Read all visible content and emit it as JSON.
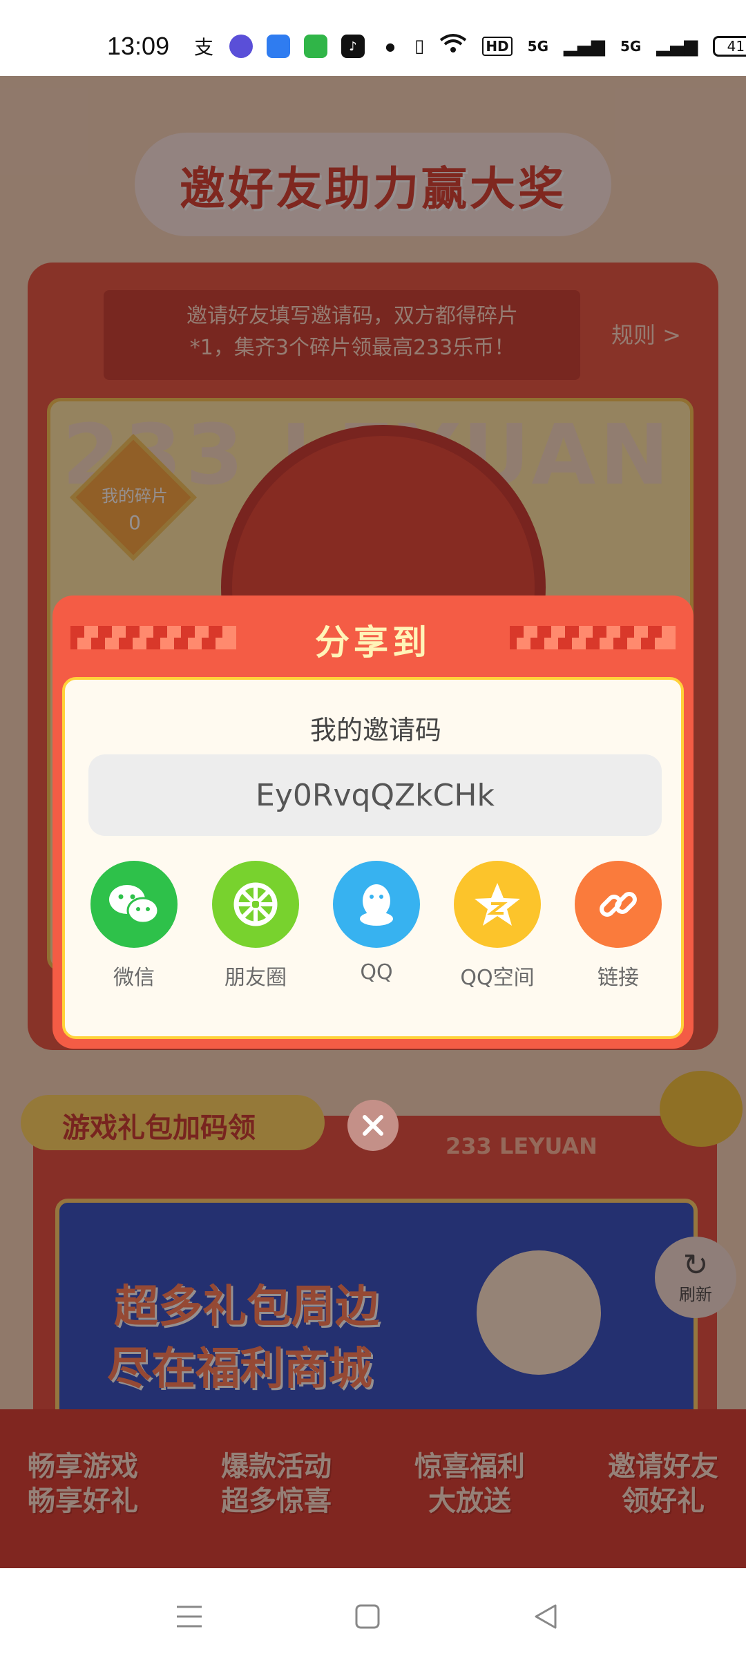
{
  "status_bar": {
    "time": "13:09",
    "battery": "41",
    "network_1": "5G",
    "network_2": "5G",
    "hd_badge": "HD"
  },
  "page": {
    "title": "邀好友助力赢大奖",
    "invite_banner_line1": "邀请好友填写邀请码，双方都得碎片",
    "invite_banner_line2": "*1，集齐3个碎片领最高233乐币！",
    "rules_link": "规则 >",
    "watermark": "233 LEYUAN",
    "my_fragments_label": "我的碎片",
    "my_fragments_count": "0",
    "gift_section_title": "游戏礼包加码领",
    "gift_brand": "233 LEYUAN",
    "promo_line1": "超多礼包周边",
    "promo_line2": "尽在福利商城",
    "refresh_label": "刷新",
    "features": [
      {
        "line1": "畅享游戏",
        "line2": "畅享好礼"
      },
      {
        "line1": "爆款活动",
        "line2": "超多惊喜"
      },
      {
        "line1": "惊喜福利",
        "line2": "大放送"
      },
      {
        "line1": "邀请好友",
        "line2": "领好礼"
      }
    ]
  },
  "modal": {
    "title": "分享到",
    "code_label": "我的邀请码",
    "invite_code": "Ey0RvqQZkCHk",
    "share_targets": [
      {
        "label": "微信",
        "icon": "wechat-icon",
        "color": "#2ec14a"
      },
      {
        "label": "朋友圈",
        "icon": "moments-icon",
        "color": "#78d22e"
      },
      {
        "label": "QQ",
        "icon": "qq-icon",
        "color": "#37b2f0"
      },
      {
        "label": "QQ空间",
        "icon": "qzone-icon",
        "color": "#fcc42b"
      },
      {
        "label": "链接",
        "icon": "link-icon",
        "color": "#fa7b3c"
      }
    ]
  },
  "colors": {
    "accent": "#f45c45",
    "modal_border": "#ffd23a"
  }
}
